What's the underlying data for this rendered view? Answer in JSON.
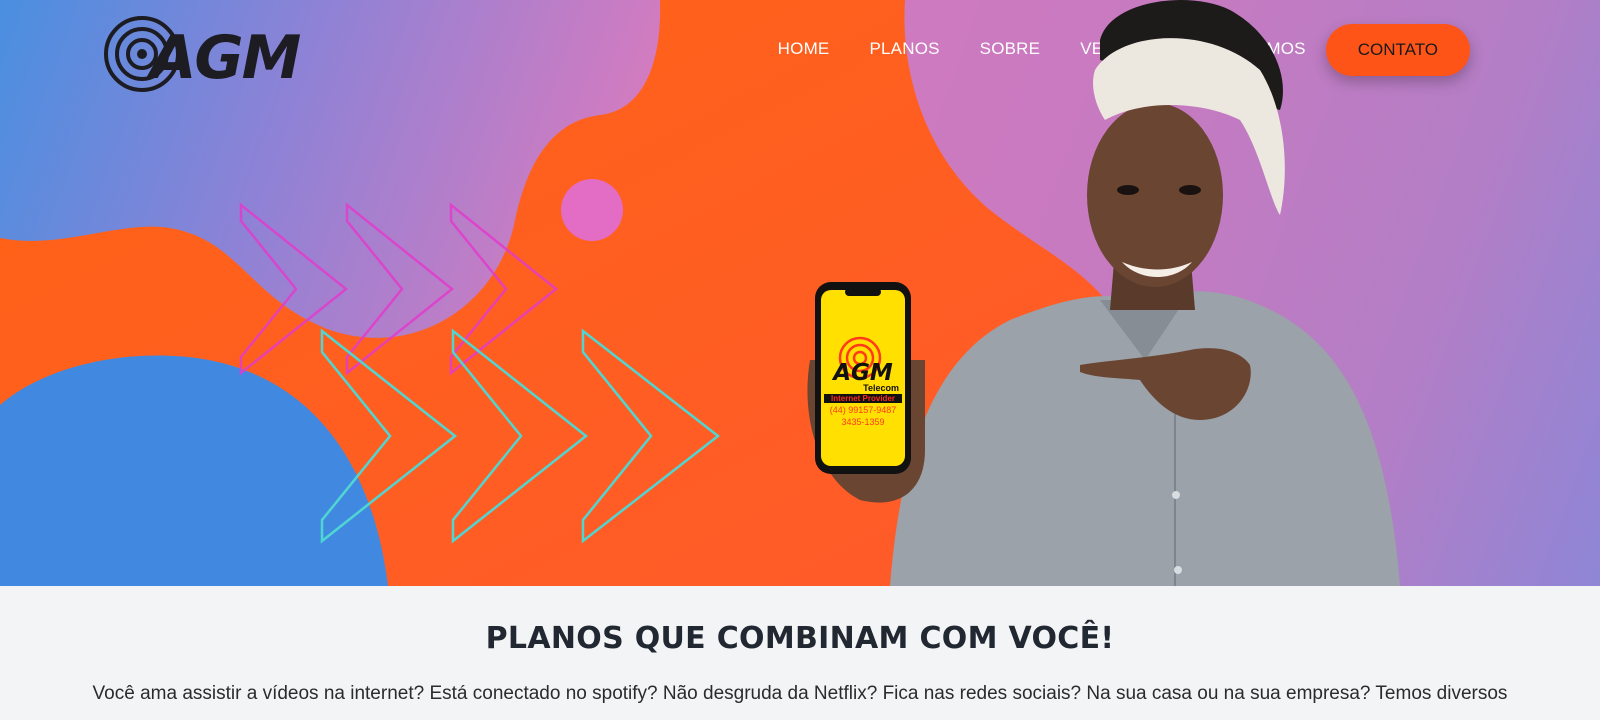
{
  "header": {
    "logo_text": "AGM",
    "nav": {
      "home": "HOME",
      "planos": "PLANOS",
      "sobre": "SOBRE",
      "velocidade": "VELOCIDADE",
      "termos": "TERMOS"
    },
    "contact_label": "CONTATO"
  },
  "hero": {
    "phone_screen": {
      "brand": "AGM",
      "subtitle": "Telecom",
      "tagline": "Internet Provider",
      "phone_1": "(44) 99157-9487",
      "phone_2": "3435-1359"
    }
  },
  "plans": {
    "title": "PLANOS QUE COMBINAM COM VOCÊ!",
    "intro": "Você ama assistir a vídeos na internet? Está conectado no spotify? Não desgruda da Netflix? Fica nas redes sociais? Na sua casa ou na sua empresa? Temos diversos"
  },
  "colors": {
    "accent_orange": "#ff5418",
    "blue_blob": "#4189e0",
    "pink_chevrons": "#e23ccc",
    "cyan_chevrons": "#4fd6d2",
    "phone_yellow": "#ffe000"
  }
}
